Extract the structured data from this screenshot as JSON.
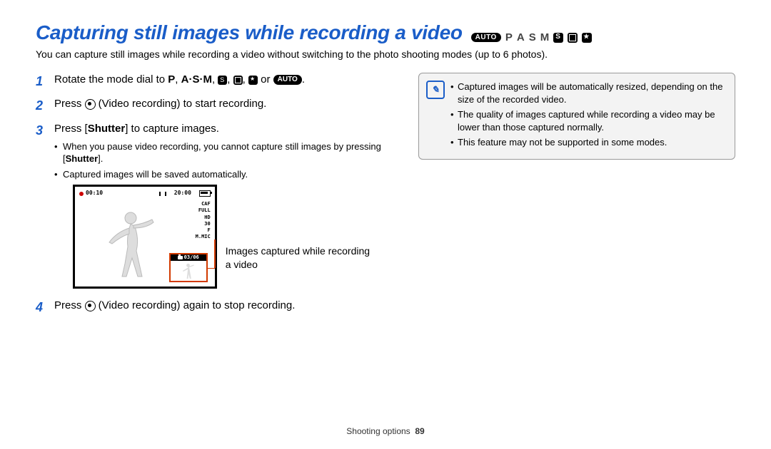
{
  "title": "Capturing still images while recording a video",
  "mode_icons": {
    "auto": "AUTO",
    "p": "P",
    "a": "A",
    "s": "S",
    "m": "M"
  },
  "intro": "You can capture still images while recording a video without switching to the photo shooting modes (up to 6 photos).",
  "steps": {
    "s1a": "Rotate the mode dial to ",
    "s1p": "P",
    "s1comma1": ", ",
    "s1asm": "A·S·M",
    "s1comma2": ", ",
    "s1or": " or ",
    "s1auto": "AUTO",
    "s1dot": ".",
    "s2a": "Press ",
    "s2b": " (Video recording) to start recording.",
    "s3a": "Press [",
    "s3shutter": "Shutter",
    "s3b": "] to capture images.",
    "s3_sub1a": "When you pause video recording, you cannot capture still images by pressing [",
    "s3_sub1shutter": "Shutter",
    "s3_sub1b": "].",
    "s3_sub2": "Captured images will be saved automatically.",
    "s4a": "Press ",
    "s4b": " (Video recording) again to stop recording."
  },
  "screen": {
    "rec_time": "00:10",
    "remain": "20:00",
    "caf": "CAF",
    "res": "FULL\nHD",
    "fps": "30\nF",
    "mic": "M.MIC",
    "thumb_count": "03/06"
  },
  "caption": "Images captured while recording a video",
  "notes": {
    "n1": "Captured images will be automatically resized, depending on the size of the recorded video.",
    "n2": "The quality of images captured while recording a video may be lower than those captured normally.",
    "n3": "This feature may not be supported in some modes."
  },
  "footer_section": "Shooting options",
  "footer_page": "89"
}
